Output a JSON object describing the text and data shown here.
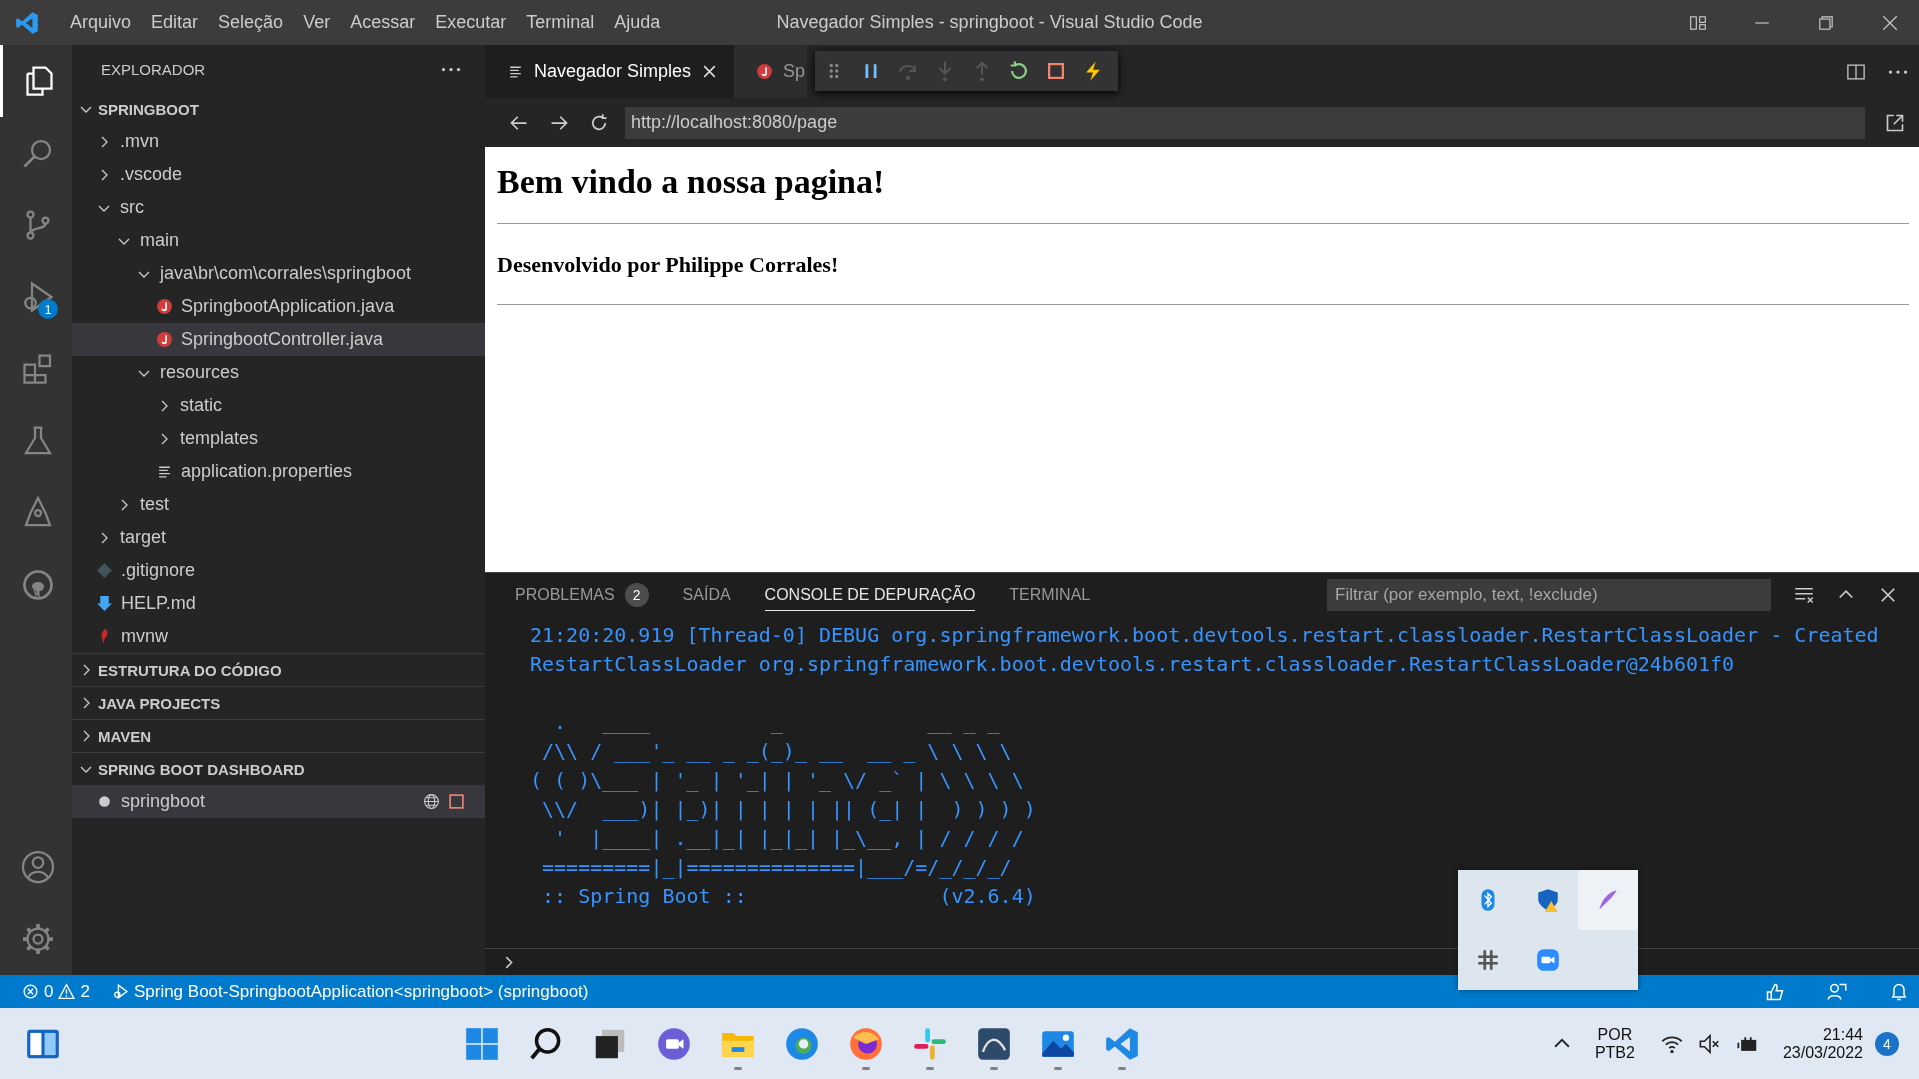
{
  "window": {
    "title": "Navegador Simples - springboot - Visual Studio Code"
  },
  "menu": [
    "Arquivo",
    "Editar",
    "Seleção",
    "Ver",
    "Acessar",
    "Executar",
    "Terminal",
    "Ajuda"
  ],
  "activity_bar": [
    {
      "kind": "files",
      "selected": true
    },
    {
      "kind": "search",
      "selected": false
    },
    {
      "kind": "git",
      "selected": false
    },
    {
      "kind": "debug",
      "selected": false,
      "badge": "1"
    },
    {
      "kind": "extensions",
      "selected": false
    },
    {
      "kind": "flask",
      "selected": false
    },
    {
      "kind": "rocket",
      "selected": false
    },
    {
      "kind": "github",
      "selected": false
    }
  ],
  "sidebar": {
    "title": "EXPLORADOR",
    "sections": [
      {
        "label": "SPRINGBOOT",
        "expanded": true,
        "tree": [
          {
            "label": ".mvn",
            "kind": "folder",
            "expanded": false,
            "selected": false
          },
          {
            "label": ".vscode",
            "kind": "folder",
            "expanded": false,
            "selected": false
          },
          {
            "label": "src",
            "kind": "folder",
            "expanded": true,
            "selected": false,
            "children": [
              {
                "label": "main",
                "kind": "folder",
                "expanded": true,
                "selected": false,
                "children": [
                  {
                    "label": "java\\br\\com\\corrales\\springboot",
                    "kind": "folder",
                    "expanded": true,
                    "selected": false,
                    "children": [
                      {
                        "label": "SpringbootApplication.java",
                        "kind": "java",
                        "selected": false
                      },
                      {
                        "label": "SpringbootController.java",
                        "kind": "java",
                        "selected": true
                      }
                    ]
                  },
                  {
                    "label": "resources",
                    "kind": "folder",
                    "expanded": true,
                    "selected": false,
                    "children": [
                      {
                        "label": "static",
                        "kind": "folder",
                        "expanded": false,
                        "selected": false
                      },
                      {
                        "label": "templates",
                        "kind": "folder",
                        "expanded": false,
                        "selected": false
                      },
                      {
                        "label": "application.properties",
                        "kind": "properties",
                        "selected": false
                      }
                    ]
                  }
                ]
              },
              {
                "label": "test",
                "kind": "folder",
                "expanded": false,
                "selected": false
              }
            ]
          },
          {
            "label": "target",
            "kind": "folder",
            "expanded": false,
            "selected": false
          },
          {
            "label": ".gitignore",
            "kind": "git",
            "selected": false
          },
          {
            "label": "HELP.md",
            "kind": "markdown",
            "selected": false
          },
          {
            "label": "mvnw",
            "kind": "mvnw",
            "selected": false
          }
        ]
      },
      {
        "label": "ESTRUTURA DO CÓDIGO",
        "expanded": false
      },
      {
        "label": "JAVA PROJECTS",
        "expanded": false
      },
      {
        "label": "MAVEN",
        "expanded": false
      },
      {
        "label": "SPRING BOOT DASHBOARD",
        "expanded": true,
        "apps": [
          {
            "name": "springboot",
            "selected": true
          }
        ]
      }
    ]
  },
  "tabs": [
    {
      "label": "Navegador Simples",
      "kind": "preview",
      "selected": true
    },
    {
      "label": "Sp",
      "kind": "java",
      "selected": false
    }
  ],
  "browser": {
    "url": "http://localhost:8080/page",
    "heading": "Bem vindo a nossa pagina!",
    "subheading": "Desenvolvido por Philippe Corrales!"
  },
  "panel": {
    "tabs": [
      {
        "label": "PROBLEMAS",
        "badge": "2",
        "selected": false
      },
      {
        "label": "SAÍDA",
        "selected": false
      },
      {
        "label": "CONSOLE DE DEPURAÇÃO",
        "selected": true
      },
      {
        "label": "TERMINAL",
        "selected": false
      }
    ],
    "filter": {
      "placeholder": "Filtrar (por exemplo, text, !exclude)"
    },
    "log": "21:20:20.919 [Thread-0] DEBUG org.springframework.boot.devtools.restart.classloader.RestartClassLoader - Created RestartClassLoader org.springframework.boot.devtools.restart.classloader.RestartClassLoader@24b601f0",
    "banner": [
      "  .   ____          _            __ _ _",
      " /\\\\ / ___'_ __ _ _(_)_ __  __ _ \\ \\ \\ \\",
      "( ( )\\___ | '_ | '_| | '_ \\/ _` | \\ \\ \\ \\",
      " \\\\/  ___)| |_)| | | | | || (_| |  ) ) ) )",
      "  '  |____| .__|_| |_|_| |_\\__, | / / / /",
      " =========|_|==============|___/=/_/_/_/",
      " :: Spring Boot ::                (v2.6.4)"
    ]
  },
  "status_bar": {
    "errors": "0",
    "warnings": "2",
    "debug": "Spring Boot-SpringbootApplication<springboot> (springboot)"
  },
  "tray_popup": [
    {
      "kind": "bluetooth",
      "selected": false
    },
    {
      "kind": "shield",
      "selected": false
    },
    {
      "kind": "feather",
      "selected": true
    },
    {
      "kind": "slack",
      "selected": false
    },
    {
      "kind": "zoom",
      "selected": false
    }
  ],
  "taskbar": {
    "apps": [
      {
        "kind": "start",
        "running": false
      },
      {
        "kind": "search",
        "running": false
      },
      {
        "kind": "taskview",
        "running": false
      },
      {
        "kind": "chat",
        "running": false
      },
      {
        "kind": "explorer",
        "running": true
      },
      {
        "kind": "edge",
        "running": false
      },
      {
        "kind": "firefox",
        "running": true
      },
      {
        "kind": "slack",
        "running": true
      },
      {
        "kind": "mysql",
        "running": true
      },
      {
        "kind": "photos",
        "running": true
      },
      {
        "kind": "vscode",
        "running": true
      }
    ],
    "language": "POR",
    "layout": "PTB2",
    "time": "21:44",
    "date": "23/03/2022",
    "notifications": "4"
  }
}
